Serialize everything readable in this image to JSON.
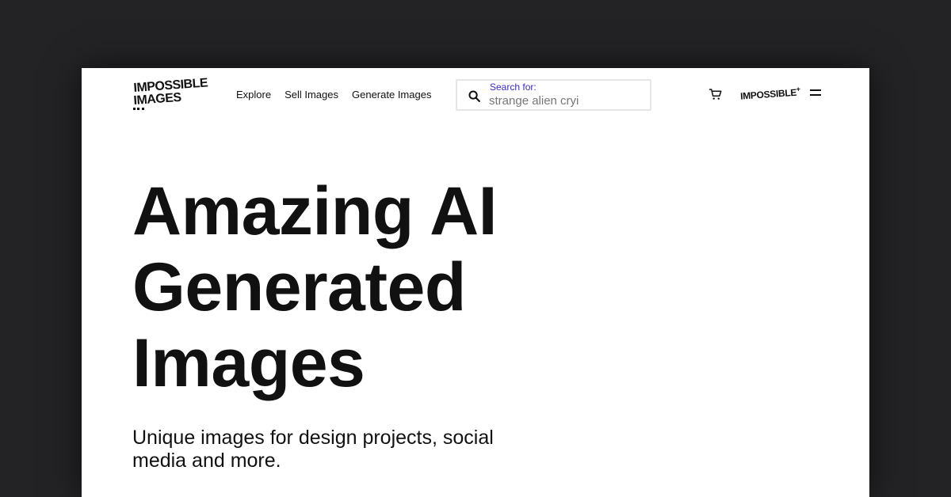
{
  "header": {
    "logo": {
      "line1": "IMPOSSIBLE",
      "line2": "IMAGES"
    },
    "nav": [
      {
        "label": "Explore"
      },
      {
        "label": "Sell Images"
      },
      {
        "label": "Generate Images"
      }
    ],
    "search": {
      "label": "Search for:",
      "placeholder": "strange alien cryi",
      "icon": "search-icon"
    },
    "cart_icon": "cart-icon",
    "plus_logo": {
      "text": "IMPOSSIBLE",
      "suffix": "+"
    },
    "menu_icon": "menu-icon"
  },
  "hero": {
    "lines": [
      "Amazing AI",
      "Generated",
      "Images"
    ],
    "subtitle": "Unique images for design projects, social media and more."
  },
  "colors": {
    "background": "#232326",
    "page": "#ffffff",
    "text": "#111111",
    "search_label": "#3b2bd1"
  }
}
